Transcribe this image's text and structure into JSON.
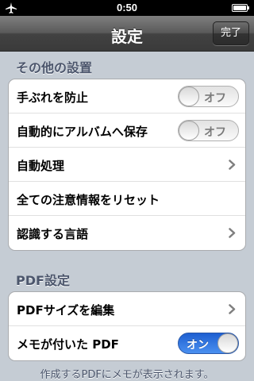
{
  "status_bar": {
    "time": "0:50",
    "airplane_icon": "airplane-icon",
    "battery_icon": "battery-icon"
  },
  "nav": {
    "title": "設定",
    "done_label": "完了"
  },
  "sections": [
    {
      "header": "その他の設置",
      "rows": [
        {
          "label": "手ぶれを防止",
          "toggle": "オフ"
        },
        {
          "label": "自動的にアルバムへ保存",
          "toggle": "オフ"
        },
        {
          "label": "自動処理"
        },
        {
          "label": "全ての注意情報をリセット"
        },
        {
          "label": "認識する言語"
        }
      ]
    },
    {
      "header": "PDF設定",
      "rows": [
        {
          "label": "PDFサイズを編集"
        },
        {
          "label": "メモが付いた PDF",
          "toggle": "オン"
        }
      ]
    }
  ],
  "footer_note": "作成するPDFにメモが表示されます。",
  "colors": {
    "toggle_on": "#2f73e0",
    "section_header": "#4c566c",
    "background": "#c5ccd4"
  }
}
